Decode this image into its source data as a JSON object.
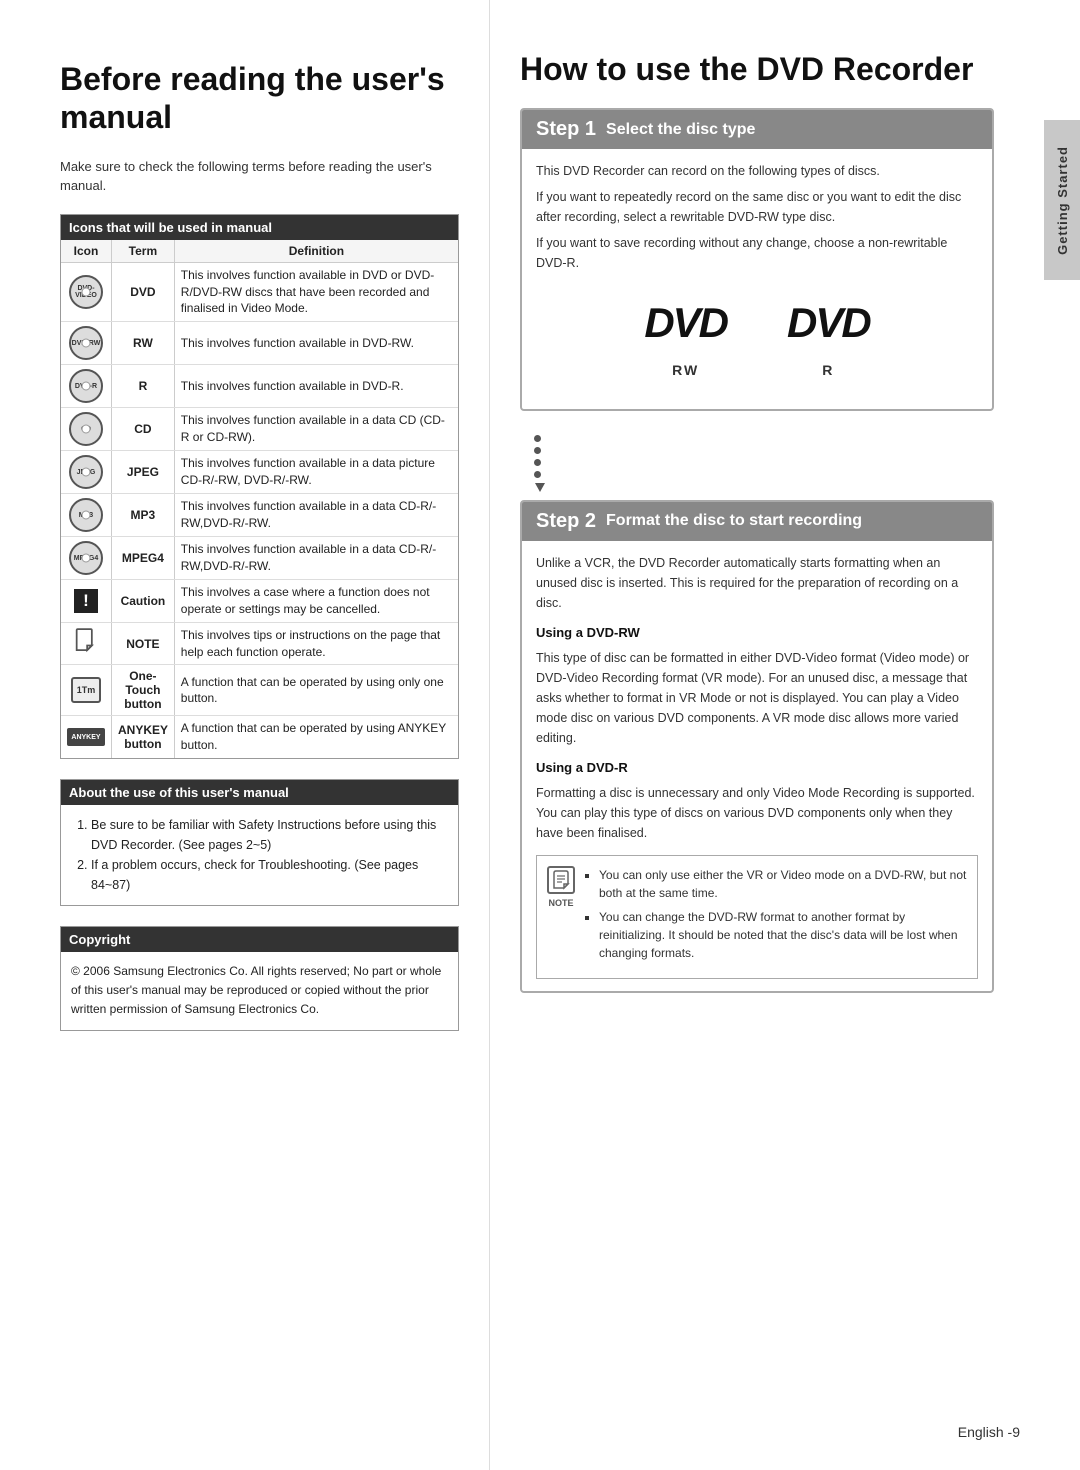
{
  "left": {
    "title": "Before reading the user's manual",
    "intro": "Make sure to check the following terms before reading the user's manual.",
    "icons_table_header": "Icons that will be used in manual",
    "table_cols": [
      "Icon",
      "Term",
      "Definition"
    ],
    "table_rows": [
      {
        "icon_type": "disc",
        "icon_label": "DVD-VIDEO",
        "term": "DVD",
        "definition": "This involves function available in DVD or DVD-R/DVD-RW discs that have been recorded and finalised in Video Mode."
      },
      {
        "icon_type": "disc",
        "icon_label": "DVD-RW",
        "term": "RW",
        "definition": "This involves function available in DVD-RW."
      },
      {
        "icon_type": "disc",
        "icon_label": "DVD-R",
        "term": "R",
        "definition": "This involves function available in DVD-R."
      },
      {
        "icon_type": "disc",
        "icon_label": "CD",
        "term": "CD",
        "definition": "This involves function available in a data CD (CD-R or CD-RW)."
      },
      {
        "icon_type": "disc",
        "icon_label": "JPEG",
        "term": "JPEG",
        "definition": "This involves function available in a data picture CD-R/-RW, DVD-R/-RW."
      },
      {
        "icon_type": "disc",
        "icon_label": "MP3",
        "term": "MP3",
        "definition": "This involves function available in a data CD-R/-RW,DVD-R/-RW."
      },
      {
        "icon_type": "disc",
        "icon_label": "MPEG4",
        "term": "MPEG4",
        "definition": "This involves function available in a data CD-R/-RW,DVD-R/-RW."
      },
      {
        "icon_type": "caution",
        "icon_label": "!",
        "term": "Caution",
        "definition": "This involves a case where a function does not operate or settings may be cancelled."
      },
      {
        "icon_type": "note",
        "icon_label": "NOTE",
        "term": "NOTE",
        "definition": "This involves tips or instructions on the page that help each function operate."
      },
      {
        "icon_type": "onetouch",
        "icon_label": "1Tm",
        "term": "One-Touch button",
        "definition": "A function that can be operated by using only one button."
      },
      {
        "icon_type": "anykey",
        "icon_label": "ANYKEY",
        "term": "ANYKEY button",
        "definition": "A function that can be operated by using ANYKEY button."
      }
    ],
    "about_header": "About the use of this user's manual",
    "about_items": [
      "Be sure to be familiar with Safety Instructions before using this DVD Recorder. (See pages 2~5)",
      "If a problem occurs, check for Troubleshooting. (See pages 84~87)"
    ],
    "copyright_header": "Copyright",
    "copyright_text": "© 2006 Samsung Electronics Co.\nAll rights reserved; No part or whole of this user's manual may be reproduced or copied without the prior written permission of Samsung Electronics Co."
  },
  "right": {
    "title": "How to use the DVD Recorder",
    "step1": {
      "number": "Step 1",
      "title": "Select the disc type",
      "intro": "This DVD Recorder can record on the following types of discs.",
      "para1": "If you want to repeatedly record on the same disc or you want to edit the disc after recording, select a rewritable DVD-RW type disc.",
      "para2": "If you want to save recording without any change, choose a non-rewritable DVD-R.",
      "dvd_rw_label": "RW",
      "dvd_r_label": "R"
    },
    "step2": {
      "number": "Step 2",
      "title": "Format the disc to start recording",
      "intro": "Unlike a VCR, the DVD Recorder automatically starts formatting when an unused disc is inserted. This is required for the preparation of recording on a disc.",
      "dvd_rw_header": "Using a DVD-RW",
      "dvd_rw_text": "This type of disc can be formatted in either DVD-Video format (Video mode) or DVD-Video Recording format (VR mode). For an unused disc, a message that asks whether to format in VR Mode or not is displayed. You can play a Video mode disc on various DVD components. A VR mode disc allows more varied editing.",
      "dvd_r_header": "Using a DVD-R",
      "dvd_r_text": "Formatting a disc is unnecessary and only Video Mode Recording is supported. You can play this type of discs on various DVD components only when they have been finalised.",
      "note_label": "NOTE",
      "note_items": [
        "You can only use either the VR or Video mode on a DVD-RW, but not both at the same time.",
        "You can change the DVD-RW format to another format by reinitializing. It should be noted that the disc's data will be lost when changing formats."
      ]
    }
  },
  "footer": {
    "language": "English",
    "page": "-9"
  },
  "sidebar": {
    "label": "Getting Started"
  }
}
